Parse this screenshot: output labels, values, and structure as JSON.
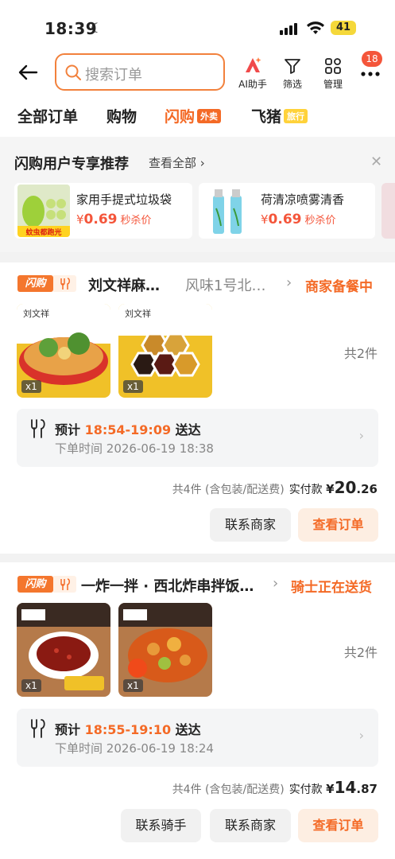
{
  "status": {
    "time": "18:39",
    "battery": "41"
  },
  "search": {
    "placeholder": "搜索订单"
  },
  "toolbar": {
    "ai_label": "AI助手",
    "filter_label": "筛选",
    "manage_label": "管理",
    "more_badge": "18"
  },
  "tabs": [
    {
      "label": "全部订单"
    },
    {
      "label": "购物"
    },
    {
      "label": "闪购",
      "tag": "外卖"
    },
    {
      "label": "飞猪",
      "tag": "旅行"
    }
  ],
  "recommend": {
    "title": "闪购用户专享推荐",
    "view_all": "查看全部",
    "items": [
      {
        "name": "家用手提式垃圾袋",
        "currency": "¥",
        "price": "0.69",
        "note": "秒杀价",
        "img_caption": "蚊虫都跑光"
      },
      {
        "name": "荷清凉喷雾清香",
        "currency": "¥",
        "price": "0.69",
        "note": "秒杀价"
      }
    ]
  },
  "orders": [
    {
      "platform": "闪购",
      "shop_name": "刘文祥麻…",
      "shop_branch": "风味1号北…",
      "status": "商家备餐中",
      "items": [
        {
          "qty": "x1"
        },
        {
          "qty": "x1"
        }
      ],
      "item_count": "共2件",
      "eta_prefix": "预计",
      "eta_time": "18:54-19:09",
      "eta_suffix": "送达",
      "order_time_label": "下单时间",
      "order_time": "2026-06-19 18:38",
      "summary": "共4件 (含包装/配送费)",
      "paid_label": "实付款",
      "paid_currency": "¥",
      "paid_int": "20",
      "paid_dec": ".26",
      "buttons": [
        "联系商家",
        "查看订单"
      ]
    },
    {
      "platform": "闪购",
      "shop_name": "一炸一拌 · 西北炸串拌饭…",
      "status": "骑士正在送货",
      "items": [
        {
          "qty": "x1"
        },
        {
          "qty": "x1"
        }
      ],
      "item_count": "共2件",
      "eta_prefix": "预计",
      "eta_time": "18:55-19:10",
      "eta_suffix": "送达",
      "order_time_label": "下单时间",
      "order_time": "2026-06-19 18:24",
      "summary": "共4件 (含包装/配送费)",
      "paid_label": "实付款",
      "paid_currency": "¥",
      "paid_int": "14",
      "paid_dec": ".87",
      "buttons": [
        "联系骑手",
        "联系商家",
        "查看订单"
      ]
    }
  ],
  "colors": {
    "accent": "#f46a26",
    "price": "#f4553a",
    "flash_tag": "#f4762d"
  }
}
